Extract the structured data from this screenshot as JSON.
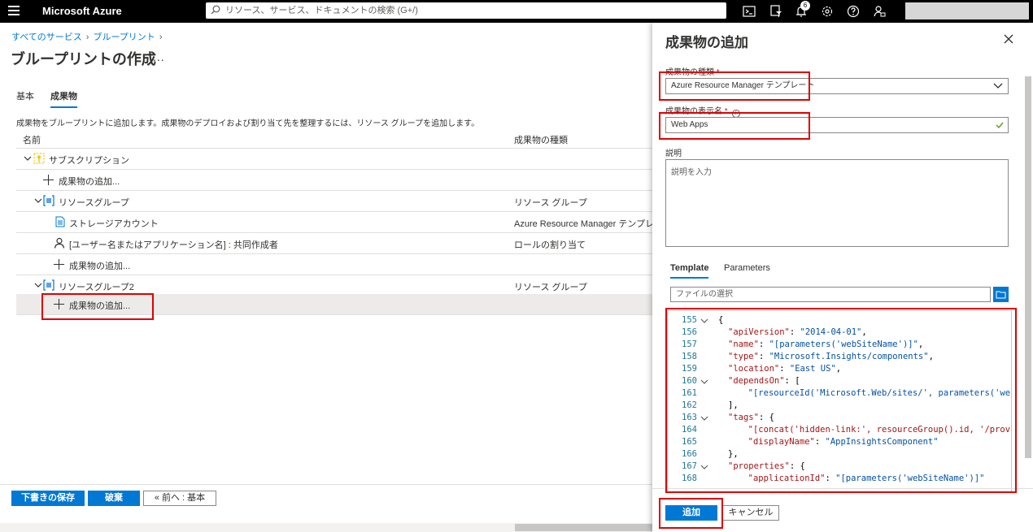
{
  "topbar": {
    "brand": "Microsoft Azure",
    "search_placeholder": "リソース、サービス、ドキュメントの検索 (G+/)",
    "notification_count": "6"
  },
  "breadcrumb": [
    "すべてのサービス",
    "ブループリント"
  ],
  "page_title": "ブループリントの作成",
  "title_more": "...",
  "tabs": [
    "基本",
    "成果物"
  ],
  "description": "成果物をブループリントに追加します。成果物のデプロイおよび割り当て先を整理するには、リソース グループを追加します。",
  "grid": {
    "col_name": "名前",
    "col_type": "成果物の種類",
    "rows": [
      {
        "name": "サブスクリプション",
        "type": ""
      },
      {
        "name": "成果物の追加...",
        "type": ""
      },
      {
        "name": "リソースグループ",
        "type": "リソース グループ"
      },
      {
        "name": "ストレージアカウント",
        "type": "Azure Resource Manager テンプレート"
      },
      {
        "name": "[ユーザー名またはアプリケーション名] : 共同作成者",
        "type": "ロールの割り当て"
      },
      {
        "name": "成果物の追加...",
        "type": ""
      },
      {
        "name": "リソースグループ2",
        "type": "リソース グループ"
      },
      {
        "name": "成果物の追加...",
        "type": ""
      }
    ]
  },
  "footer": {
    "save_draft": "下書きの保存",
    "discard": "破棄",
    "previous": "« 前へ : 基本"
  },
  "panel": {
    "title": "成果物の追加",
    "type_label": "成果物の種類",
    "type_value": "Azure Resource Manager テンプレート",
    "display_name_label": "成果物の表示名",
    "display_name_value": "Web Apps",
    "desc_label": "説明",
    "desc_placeholder": "説明を入力",
    "required_mark": "*",
    "tabs": [
      "Template",
      "Parameters"
    ],
    "file_placeholder": "ファイルの選択",
    "code": [
      {
        "ln": "155",
        "fold": true,
        "parts": [
          [
            "p",
            "{"
          ]
        ]
      },
      {
        "ln": "156",
        "fold": false,
        "parts": [
          [
            "k",
            "\"apiVersion\""
          ],
          [
            "p",
            ": "
          ],
          [
            "s",
            "\"2014-04-01\""
          ],
          [
            "p",
            ","
          ]
        ]
      },
      {
        "ln": "157",
        "fold": false,
        "parts": [
          [
            "k",
            "\"name\""
          ],
          [
            "p",
            ": "
          ],
          [
            "s",
            "\"[parameters('webSiteName')]\""
          ],
          [
            "p",
            ","
          ]
        ]
      },
      {
        "ln": "158",
        "fold": false,
        "parts": [
          [
            "k",
            "\"type\""
          ],
          [
            "p",
            ": "
          ],
          [
            "s",
            "\"Microsoft.Insights/components\""
          ],
          [
            "p",
            ","
          ]
        ]
      },
      {
        "ln": "159",
        "fold": false,
        "parts": [
          [
            "k",
            "\"location\""
          ],
          [
            "p",
            ": "
          ],
          [
            "s",
            "\"East US\""
          ],
          [
            "p",
            ","
          ]
        ]
      },
      {
        "ln": "160",
        "fold": true,
        "parts": [
          [
            "k",
            "\"dependsOn\""
          ],
          [
            "p",
            ": ["
          ]
        ]
      },
      {
        "ln": "161",
        "fold": false,
        "parts": [
          [
            "p",
            "  "
          ],
          [
            "s",
            "\"[resourceId('Microsoft.Web/sites/', parameters('we"
          ]
        ]
      },
      {
        "ln": "162",
        "fold": false,
        "parts": [
          [
            "p",
            "],"
          ]
        ]
      },
      {
        "ln": "163",
        "fold": true,
        "parts": [
          [
            "k",
            "\"tags\""
          ],
          [
            "p",
            ": {"
          ]
        ]
      },
      {
        "ln": "164",
        "fold": false,
        "parts": [
          [
            "p",
            "  "
          ],
          [
            "k",
            "\"[concat('hidden-link:', resourceGroup().id, '/prov"
          ]
        ]
      },
      {
        "ln": "165",
        "fold": false,
        "parts": [
          [
            "p",
            "  "
          ],
          [
            "k",
            "\"displayName\""
          ],
          [
            "p",
            ": "
          ],
          [
            "s",
            "\"AppInsightsComponent\""
          ]
        ]
      },
      {
        "ln": "166",
        "fold": false,
        "parts": [
          [
            "p",
            "},"
          ]
        ]
      },
      {
        "ln": "167",
        "fold": true,
        "parts": [
          [
            "k",
            "\"properties\""
          ],
          [
            "p",
            ": {"
          ]
        ]
      },
      {
        "ln": "168",
        "fold": false,
        "parts": [
          [
            "p",
            "  "
          ],
          [
            "k",
            "\"applicationId\""
          ],
          [
            "p",
            ": "
          ],
          [
            "s",
            "\"[parameters('webSiteName')]\""
          ]
        ]
      }
    ],
    "add_button": "追加",
    "cancel_button": "キャンセル"
  },
  "colors": {
    "accent": "#0078d4",
    "annotation_red": "#e00000",
    "topbar": "#000000"
  }
}
